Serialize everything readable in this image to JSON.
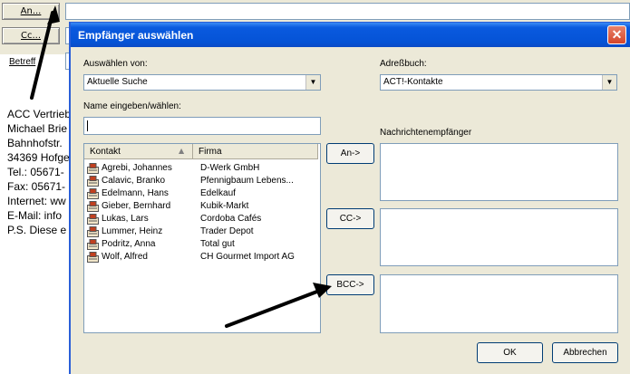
{
  "compose": {
    "to_button": "An...",
    "cc_button": "Cc...",
    "subject_label": "Betreff",
    "signature": [
      "ACC Vertrieb",
      "Michael Brie",
      "Bahnhofstr.",
      "34369 Hofge",
      "Tel.: 05671-",
      "Fax: 05671-",
      "Internet: ww",
      "E-Mail: info",
      "P.S. Diese e"
    ]
  },
  "dialog": {
    "title": "Empfänger auswählen",
    "close_glyph": "✕",
    "select_from_label": "Auswählen von:",
    "select_from_value": "Aktuelle Suche",
    "address_book_label": "Adreßbuch:",
    "address_book_value": "ACT!-Kontakte",
    "name_label": "Name eingeben/wählen:",
    "name_value": "",
    "recipients_label": "Nachrichtenempfänger",
    "columns": [
      "Kontakt",
      "Firma"
    ],
    "contacts": [
      {
        "name": "Agrebi, Johannes",
        "company": "D-Werk GmbH"
      },
      {
        "name": "Calavic, Branko",
        "company": "Pfennigbaum Lebens..."
      },
      {
        "name": "Edelmann, Hans",
        "company": "Edelkauf"
      },
      {
        "name": "Gieber, Bernhard",
        "company": "Kubik-Markt"
      },
      {
        "name": "Lukas, Lars",
        "company": "Cordoba Cafés"
      },
      {
        "name": "Lummer, Heinz",
        "company": "Trader Depot"
      },
      {
        "name": "Podritz, Anna",
        "company": "Total gut"
      },
      {
        "name": "Wolf, Alfred",
        "company": "CH Gourmet Import AG"
      }
    ],
    "to_button": "An->",
    "cc_button": "CC->",
    "bcc_button": "BCC->",
    "ok_button": "OK",
    "cancel_button": "Abbrechen"
  },
  "colors": {
    "titlebar": "#0553d6",
    "dialog_bg": "#ece9d8",
    "annotation_arrow": "#000000"
  }
}
